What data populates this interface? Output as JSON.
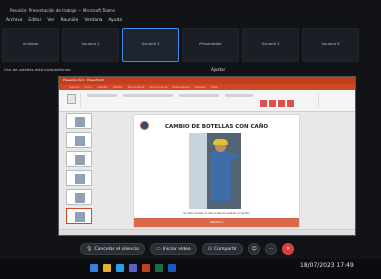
{
  "title_bar": "Reunión: Presentación de trabajo — Microsoft Teams",
  "menu": [
    "Archivo",
    "Editar",
    "Ver",
    "Reunión",
    "Ventana",
    "Ayuda"
  ],
  "participants": [
    "Invitado",
    "Usuario 2",
    "Usuario 3",
    "Presentador",
    "Usuario 5",
    "Usuario 6"
  ],
  "sharing_label": "Uno de ustedes está compartiendo",
  "zoom": "Ajustar",
  "ppt": {
    "window_title": "Presentación1 - PowerPoint",
    "tabs": [
      "Archivo",
      "Inicio",
      "Insertar",
      "Diseño",
      "Transiciones",
      "Animaciones",
      "Presentación",
      "Revisar",
      "Vista"
    ],
    "slide_title": "CAMBIO DE BOTELLAS CON CAÑO",
    "caption": "Se debe revisar el caño antes de realizar el cambio",
    "footer": "GRUPO 4"
  },
  "controls": {
    "cancel": "Cancelar el silencio",
    "video": "Iniciar vídeo",
    "share": "Compartir"
  },
  "clock": "18/07/2023 17:49",
  "colors": {
    "accent": "#3d8df0",
    "end_call": "#d83b3b",
    "ppt_brand": "#c43e1c"
  }
}
